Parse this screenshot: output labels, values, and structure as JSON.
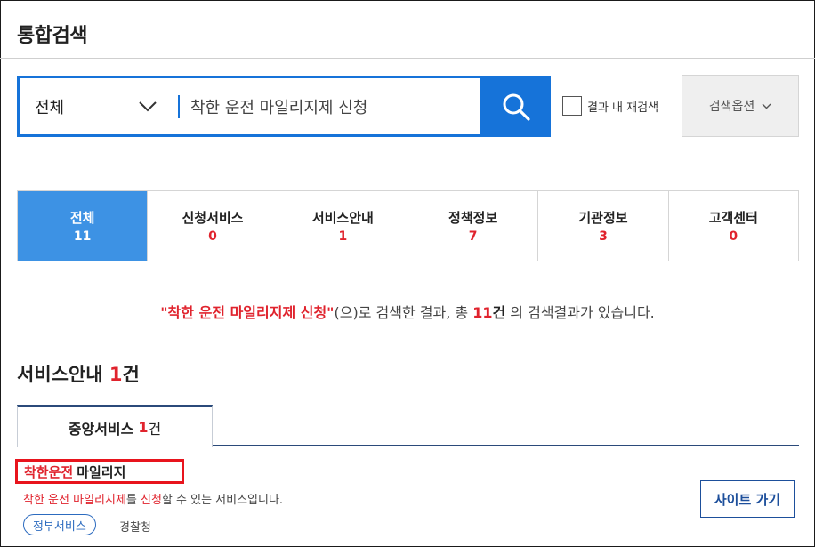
{
  "header": {
    "title": "통합검색"
  },
  "search": {
    "category": "전체",
    "query": "착한 운전 마일리지제 신청",
    "recheck_label": "결과 내 재검색",
    "options_label": "검색옵션"
  },
  "tabs": [
    {
      "label": "전체",
      "count": "11",
      "active": true
    },
    {
      "label": "신청서비스",
      "count": "0"
    },
    {
      "label": "서비스안내",
      "count": "1"
    },
    {
      "label": "정책정보",
      "count": "7"
    },
    {
      "label": "기관정보",
      "count": "3"
    },
    {
      "label": "고객센터",
      "count": "0"
    }
  ],
  "summary": {
    "keyword": "\"착한 운전 마일리지제 신청\"",
    "pre": "(으)로 검색한 결과, 총 ",
    "count": "11",
    "count_unit": "건",
    "post": " 의 검색결과가 있습니다."
  },
  "section": {
    "title": "서비스안내",
    "count": "1",
    "unit": "건"
  },
  "subtab": {
    "label": "중앙서비스",
    "count": "1",
    "unit": "건"
  },
  "result": {
    "title_hl": "착한운전",
    "title_rest": "마일리지",
    "desc_hl1": "착한 운전 마일리지제",
    "desc_mid": "를 ",
    "desc_hl2": "신청",
    "desc_end": "할 수 있는 서비스입니다.",
    "badge": "정부서비스",
    "agency": "경찰청",
    "button": "사이트 가기"
  },
  "colors": {
    "accent": "#1673d9",
    "active_tab": "#3d92e4",
    "highlight": "#e0232d",
    "navy": "#2b4a7a"
  }
}
